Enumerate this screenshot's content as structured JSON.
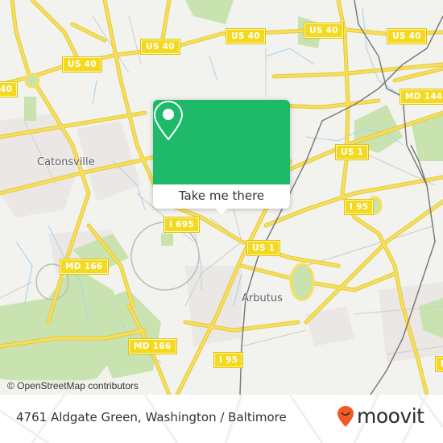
{
  "map": {
    "place_labels": [
      {
        "name": "Catonsville"
      },
      {
        "name": "Arbutus"
      }
    ],
    "route_shields": [
      {
        "label": "US 40"
      },
      {
        "label": "US 40"
      },
      {
        "label": "US 40"
      },
      {
        "label": "US 40"
      },
      {
        "label": "40"
      },
      {
        "label": "MD 144"
      },
      {
        "label": "US 1"
      },
      {
        "label": "US 1"
      },
      {
        "label": "I 695"
      },
      {
        "label": "I 95"
      },
      {
        "label": "I 95"
      },
      {
        "label": "MD 166"
      },
      {
        "label": "MD 166"
      }
    ],
    "attribution": "© OpenStreetMap contributors",
    "colors": {
      "land": "#f2f2ee",
      "road_major": "#f7df5c",
      "park": "#c9e3b0",
      "water": "#a8d0ea",
      "rail": "#7a7a7a"
    }
  },
  "popup": {
    "icon": "map-pin-icon",
    "button_label": "Take me there",
    "accent_color": "#1fb96a"
  },
  "footer": {
    "address": "4761 Aldgate Green, Washington / Baltimore",
    "brand": "moovit",
    "brand_icon": "moovit-pin-smile-icon",
    "brand_color": "#f15a24"
  }
}
